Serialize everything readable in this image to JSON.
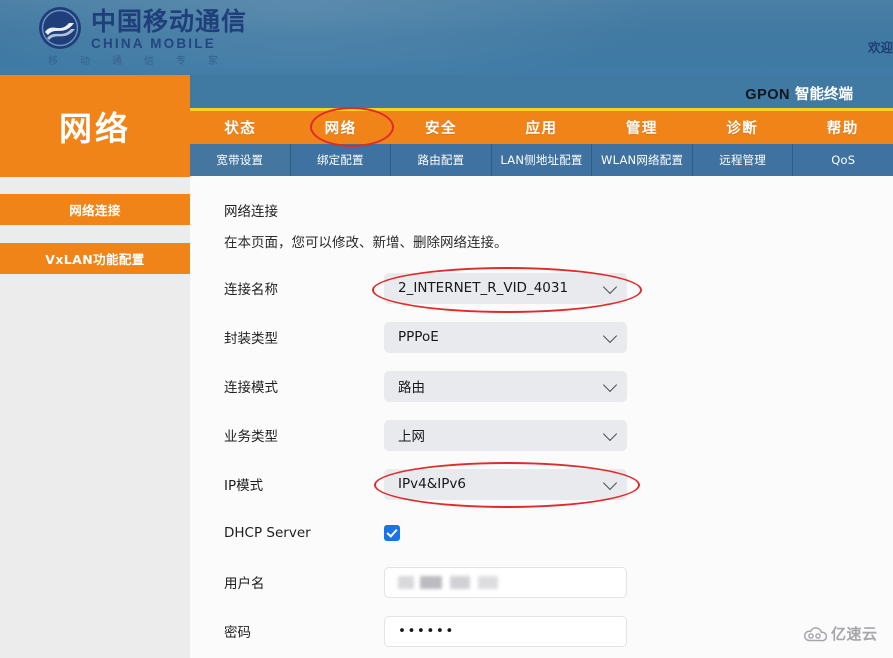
{
  "banner": {
    "logo_cn": "中国移动通信",
    "logo_en": "CHINA MOBILE",
    "tagline": [
      "移",
      "动",
      "通",
      "信",
      "专",
      "家"
    ],
    "welcome": "欢迎"
  },
  "device": {
    "model": "GPON",
    "type": "智能终端"
  },
  "sidebar": {
    "title": "网络",
    "items": [
      {
        "label": "网络连接"
      },
      {
        "label": "VxLAN功能配置"
      }
    ]
  },
  "nav": {
    "items": [
      {
        "label": "状态"
      },
      {
        "label": "网络"
      },
      {
        "label": "安全"
      },
      {
        "label": "应用"
      },
      {
        "label": "管理"
      },
      {
        "label": "诊断"
      },
      {
        "label": "帮助"
      }
    ],
    "active": "网络"
  },
  "subtabs": {
    "items": [
      {
        "label": "宽带设置"
      },
      {
        "label": "绑定配置"
      },
      {
        "label": "路由配置"
      },
      {
        "label": "LAN侧地址配置"
      },
      {
        "label": "WLAN网络配置"
      },
      {
        "label": "远程管理"
      },
      {
        "label": "QoS"
      }
    ],
    "active": "宽带设置"
  },
  "content": {
    "title": "网络连接",
    "description": "在本页面，您可以修改、新增、删除网络连接。",
    "fields": [
      {
        "label": "连接名称",
        "value": "2_INTERNET_R_VID_4031",
        "control": "select"
      },
      {
        "label": "封装类型",
        "value": "PPPoE",
        "control": "select"
      },
      {
        "label": "连接模式",
        "value": "路由",
        "control": "select"
      },
      {
        "label": "业务类型",
        "value": "上网",
        "control": "select"
      },
      {
        "label": "IP模式",
        "value": "IPv4&IPv6",
        "control": "select"
      },
      {
        "label": "DHCP Server",
        "value": "",
        "control": "checkbox",
        "checked": true
      },
      {
        "label": "用户名",
        "value": "",
        "control": "text",
        "redacted": true
      },
      {
        "label": "密码",
        "value": "••••••",
        "control": "password"
      }
    ]
  },
  "annotations": {
    "circles": [
      "网络",
      "连接名称",
      "IP模式"
    ],
    "color": "#e02b2b"
  },
  "watermark": {
    "text": "亿速云",
    "icon": "cloud-icon"
  },
  "colors": {
    "brand_orange": "#f08418",
    "header_blue": "#4079a2",
    "subtab_blue": "#3f72a0",
    "accent_yellow": "#f5d21e",
    "checkbox_blue": "#1a73e8",
    "annotation_red": "#e02b2b"
  }
}
